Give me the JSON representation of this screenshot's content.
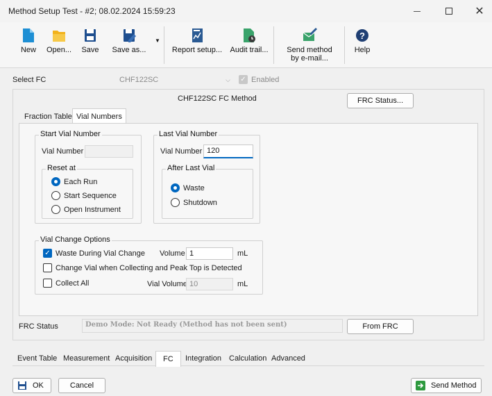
{
  "window": {
    "title": "Method Setup Test - #2;  08.02.2024  15:59:23"
  },
  "toolbar": {
    "new": "New",
    "open": "Open...",
    "save": "Save",
    "save_as": "Save as...",
    "report_setup": "Report setup...",
    "audit_trail": "Audit trail...",
    "send_method_email": "Send method by e-mail...",
    "help": "Help"
  },
  "select_fc": {
    "label": "Select FC",
    "value": "CHF122SC",
    "enabled_label": "Enabled"
  },
  "fc_method": {
    "title": "CHF122SC FC Method",
    "frc_status_button": "FRC Status..."
  },
  "inner_tabs": [
    "Fraction Table",
    "Vial Numbers"
  ],
  "start_vial": {
    "group": "Start Vial Number",
    "vial_label": "Vial Number",
    "vial_value": "",
    "reset_group": "Reset at",
    "options": [
      "Each Run",
      "Start Sequence",
      "Open Instrument"
    ],
    "selected": "Each Run"
  },
  "last_vial": {
    "group": "Last Vial Number",
    "vial_label": "Vial Number",
    "vial_value": "120",
    "after_group": "After Last Vial",
    "options": [
      "Waste",
      "Shutdown"
    ],
    "selected": "Waste"
  },
  "vial_change": {
    "group": "Vial Change Options",
    "waste_during": "Waste During Vial Change",
    "waste_checked": true,
    "volume_label": "Volume",
    "volume_value": "1",
    "volume_unit": "mL",
    "change_peak": "Change Vial when Collecting and Peak Top is Detected",
    "change_peak_checked": false,
    "collect_all": "Collect All",
    "collect_all_checked": false,
    "vial_volume_label": "Vial Volume",
    "vial_volume_value": "10",
    "vial_volume_unit": "mL"
  },
  "frc_status": {
    "label": "FRC Status",
    "value": "Demo Mode: Not Ready (Method has not been sent)",
    "from_frc_button": "From FRC"
  },
  "bottom_tabs": [
    "Event Table",
    "Measurement",
    "Acquisition",
    "FC",
    "Integration",
    "Calculation",
    "Advanced"
  ],
  "footer": {
    "ok": "OK",
    "cancel": "Cancel",
    "send_method": "Send Method"
  }
}
